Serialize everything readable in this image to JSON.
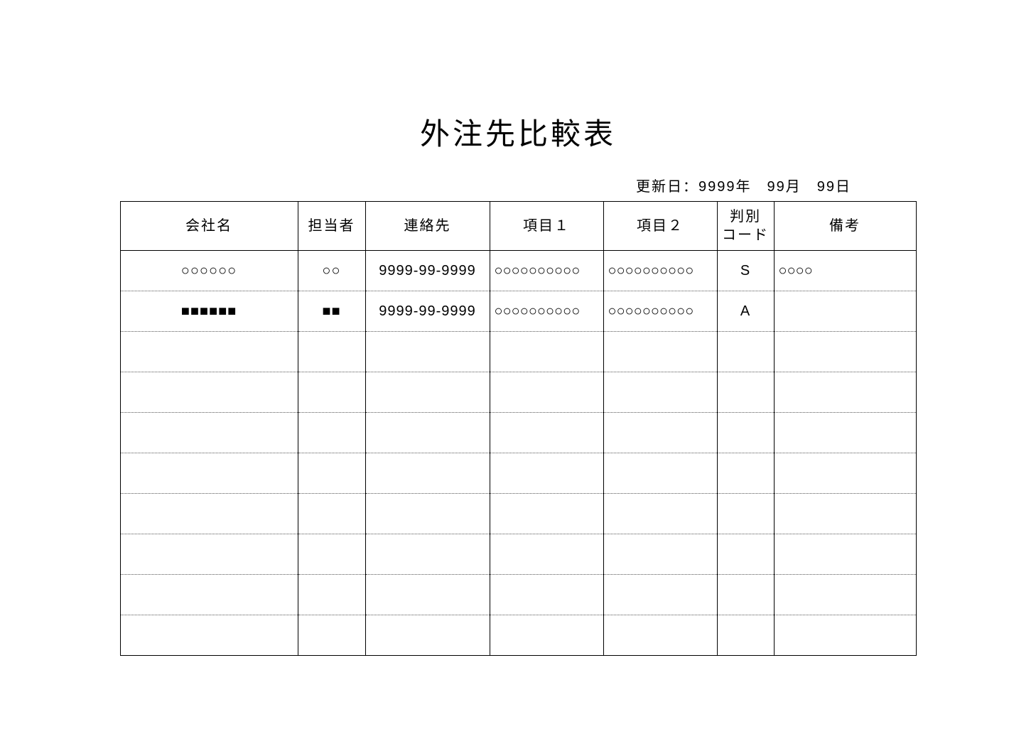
{
  "title": "外注先比較表",
  "update_label": "更新日：9999年　99月　99日",
  "headers": {
    "company": "会社名",
    "person": "担当者",
    "contact": "連絡先",
    "item1": "項目１",
    "item2": "項目２",
    "code": "判別\nコード",
    "notes": "備考"
  },
  "rows": [
    {
      "company": "○○○○○○",
      "person": "○○",
      "contact": "9999-99-9999",
      "item1": "○○○○○○○○○○",
      "item2": "○○○○○○○○○○",
      "code": "S",
      "notes": "○○○○"
    },
    {
      "company": "■■■■■■",
      "person": "■■",
      "contact": "9999-99-9999",
      "item1": "○○○○○○○○○○",
      "item2": "○○○○○○○○○○",
      "code": "A",
      "notes": ""
    },
    {
      "company": "",
      "person": "",
      "contact": "",
      "item1": "",
      "item2": "",
      "code": "",
      "notes": ""
    },
    {
      "company": "",
      "person": "",
      "contact": "",
      "item1": "",
      "item2": "",
      "code": "",
      "notes": ""
    },
    {
      "company": "",
      "person": "",
      "contact": "",
      "item1": "",
      "item2": "",
      "code": "",
      "notes": ""
    },
    {
      "company": "",
      "person": "",
      "contact": "",
      "item1": "",
      "item2": "",
      "code": "",
      "notes": ""
    },
    {
      "company": "",
      "person": "",
      "contact": "",
      "item1": "",
      "item2": "",
      "code": "",
      "notes": ""
    },
    {
      "company": "",
      "person": "",
      "contact": "",
      "item1": "",
      "item2": "",
      "code": "",
      "notes": ""
    },
    {
      "company": "",
      "person": "",
      "contact": "",
      "item1": "",
      "item2": "",
      "code": "",
      "notes": ""
    },
    {
      "company": "",
      "person": "",
      "contact": "",
      "item1": "",
      "item2": "",
      "code": "",
      "notes": ""
    }
  ]
}
